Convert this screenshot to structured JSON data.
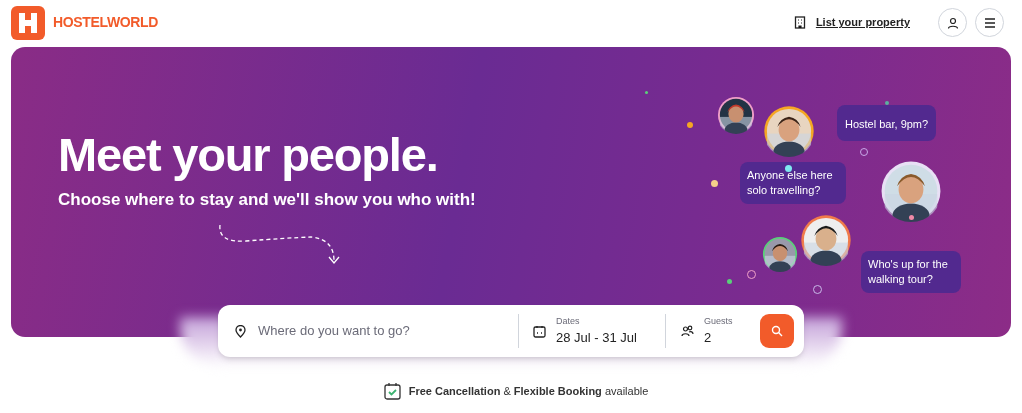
{
  "header": {
    "logo": "HOSTELWORLD",
    "list_property": "List your property"
  },
  "hero": {
    "title": "Meet your people.",
    "subtitle": "Choose where to stay and we'll show you who with!",
    "bubbles": [
      {
        "text": "Hostel bar, 9pm?"
      },
      {
        "text": "Anyone else here solo travelling?"
      },
      {
        "text": "Who's up for the walking tour?"
      }
    ]
  },
  "search": {
    "placeholder": "Where do you want to go?",
    "dates_label": "Dates",
    "dates_value": "28 Jul - 31 Jul",
    "guests_label": "Guests",
    "guests_value": "2"
  },
  "notice": "**Free Cancellation** & **Flexible Booking** available"
}
